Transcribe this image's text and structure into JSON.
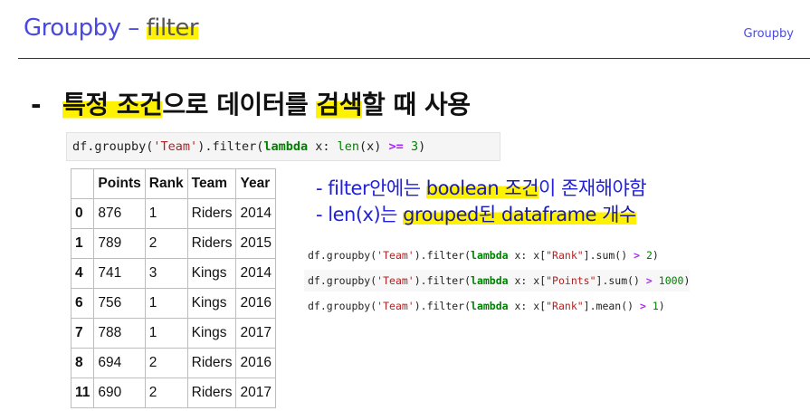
{
  "header": {
    "title_prefix": "Groupby – ",
    "title_highlight": "filter",
    "section_tag": "Groupby"
  },
  "bullet": {
    "dash": "-",
    "hl1": "특정 조건",
    "t1": "으로 데이터를 ",
    "hl2": "검색",
    "t2": "할 때 사용"
  },
  "code_main": {
    "p1": "df.groupby(",
    "s1": "'Team'",
    "p2": ").filter(",
    "kw": "lambda",
    "p3": " x: ",
    "fn": "len",
    "p4": "(x) ",
    "op": ">=",
    "sp": " ",
    "num": "3",
    "p5": ")"
  },
  "table": {
    "columns": [
      "",
      "Points",
      "Rank",
      "Team",
      "Year"
    ],
    "rows": [
      [
        "0",
        "876",
        "1",
        "Riders",
        "2014"
      ],
      [
        "1",
        "789",
        "2",
        "Riders",
        "2015"
      ],
      [
        "4",
        "741",
        "3",
        "Kings",
        "2014"
      ],
      [
        "6",
        "756",
        "1",
        "Kings",
        "2016"
      ],
      [
        "7",
        "788",
        "1",
        "Kings",
        "2017"
      ],
      [
        "8",
        "694",
        "2",
        "Riders",
        "2016"
      ],
      [
        "11",
        "690",
        "2",
        "Riders",
        "2017"
      ]
    ]
  },
  "notes": {
    "n1_a": "- filter안에는 ",
    "n1_hl": "boolean 조건",
    "n1_b": "이 존재해야함",
    "n2_a": "- len(x)는 ",
    "n2_hl": "grouped된 dataframe 개수"
  },
  "examples": [
    {
      "p1": "df.groupby(",
      "s1": "'Team'",
      "p2": ").filter(",
      "kw": "lambda",
      "p3": " x: x[",
      "s2": "\"Rank\"",
      "p4": "].sum() ",
      "op": ">",
      "sp": " ",
      "num": "2",
      "p5": ")"
    },
    {
      "p1": "df.groupby(",
      "s1": "'Team'",
      "p2": ").filter(",
      "kw": "lambda",
      "p3": " x: x[",
      "s2": "\"Points\"",
      "p4": "].sum() ",
      "op": ">",
      "sp": " ",
      "num": "1000",
      "p5": ")"
    },
    {
      "p1": "df.groupby(",
      "s1": "'Team'",
      "p2": ").filter(",
      "kw": "lambda",
      "p3": " x: x[",
      "s2": "\"Rank\"",
      "p4": "].mean() ",
      "op": ">",
      "sp": " ",
      "num": "1",
      "p5": ")"
    }
  ]
}
